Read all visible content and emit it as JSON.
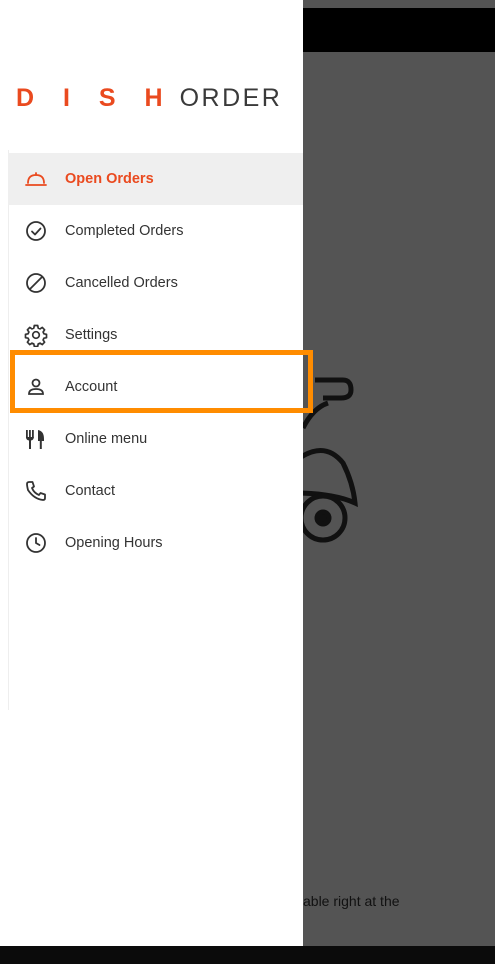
{
  "logo": {
    "brand": "D I S H",
    "suffix": "ORDER"
  },
  "menu": {
    "items": [
      {
        "label": "Open Orders",
        "icon": "cloche-icon",
        "active": true
      },
      {
        "label": "Completed Orders",
        "icon": "check-circle-icon"
      },
      {
        "label": "Cancelled Orders",
        "icon": "cancel-circle-icon"
      },
      {
        "label": "Settings",
        "icon": "gear-icon"
      },
      {
        "label": "Account",
        "icon": "person-icon",
        "highlighted": true
      },
      {
        "label": "Online menu",
        "icon": "fork-knife-icon"
      },
      {
        "label": "Contact",
        "icon": "phone-icon"
      },
      {
        "label": "Opening Hours",
        "icon": "clock-icon"
      }
    ]
  },
  "background": {
    "text": "able right at the"
  },
  "colors": {
    "accent": "#ea4a1f",
    "highlight": "#ff8c00",
    "backdrop": "#545454"
  }
}
